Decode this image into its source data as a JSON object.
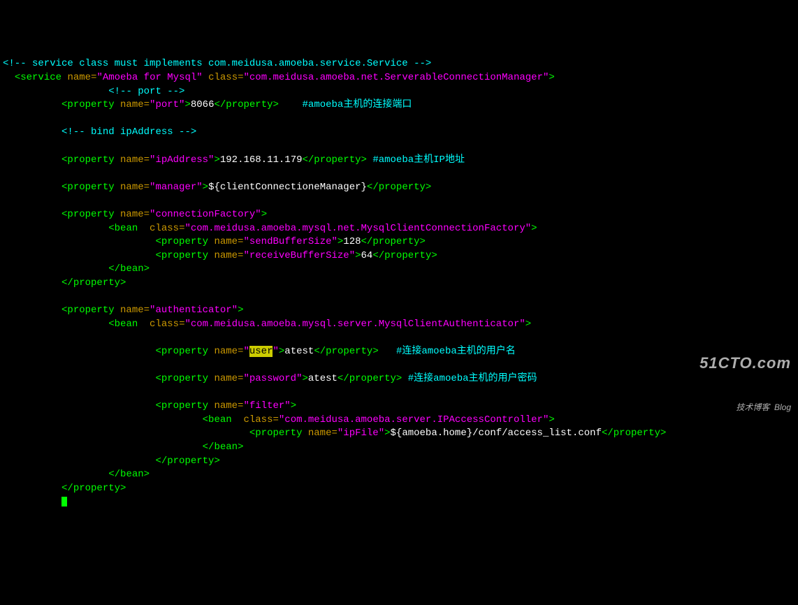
{
  "comment_service": "<!-- service class must implements com.meidusa.amoeba.service.Service -->",
  "service_open": "<service ",
  "name_attr": "name=",
  "service_name": "\"Amoeba for Mysql\"",
  "class_attr": " class=",
  "service_class": "\"com.meidusa.amoeba.net.ServerableConnectionManager\"",
  "close_tag": ">",
  "comment_port": "<!-- port -->",
  "prop_open": "<property ",
  "prop_close": "</property>",
  "port_name": "\"port\"",
  "port_val": "8066",
  "port_comment": "#amoeba主机的连接端口",
  "comment_bind": "<!-- bind ipAddress -->",
  "ip_name": "\"ipAddress\"",
  "ip_val": "192.168.11.179",
  "ip_comment": "#amoeba主机IP地址",
  "mgr_name": "\"manager\"",
  "mgr_val": "${clientConnectioneManager}",
  "cf_name": "\"connectionFactory\"",
  "bean_open": "<bean ",
  "bean_close": "</bean>",
  "cf_class": "\"com.meidusa.amoeba.mysql.net.MysqlClientConnectionFactory\"",
  "sbs_name": "\"sendBufferSize\"",
  "sbs_val": "128",
  "rbs_name": "\"receiveBufferSize\"",
  "rbs_val": "64",
  "auth_name": "\"authenticator\"",
  "auth_class": "\"com.meidusa.amoeba.mysql.server.MysqlClientAuthenticator\"",
  "user_q1": "\"",
  "user_lit": "user",
  "user_q2": "\"",
  "user_val": "atest",
  "user_comment": "#连接amoeba主机的用户名",
  "pw_name": "\"password\"",
  "pw_val": "atest",
  "pw_comment": "#连接amoeba主机的用户密码",
  "filter_name": "\"filter\"",
  "ipac_class": "\"com.meidusa.amoeba.server.IPAccessController\"",
  "ipfile_name": "\"ipFile\"",
  "ipfile_val": "${amoeba.home}/conf/access_list.conf",
  "watermark_main": "51CTO.com",
  "watermark_sub": "技术博客  Blog"
}
